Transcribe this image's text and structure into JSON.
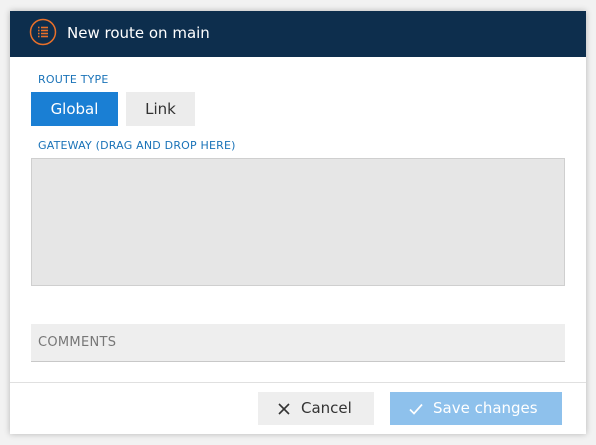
{
  "header": {
    "title": "New route on main",
    "icon": "list-icon",
    "accent": "#e8702a",
    "background": "#0d2e4d"
  },
  "route_type": {
    "label": "ROUTE TYPE",
    "options": [
      "Global",
      "Link"
    ],
    "selected": "Global"
  },
  "gateway": {
    "label": "GATEWAY (DRAG AND DROP HERE)"
  },
  "comments": {
    "placeholder": "COMMENTS",
    "value": ""
  },
  "footer": {
    "cancel_label": "Cancel",
    "save_label": "Save changes"
  },
  "colors": {
    "primary": "#1a7fd4",
    "save_disabled": "#8ec1ec",
    "label": "#1a73b8"
  }
}
